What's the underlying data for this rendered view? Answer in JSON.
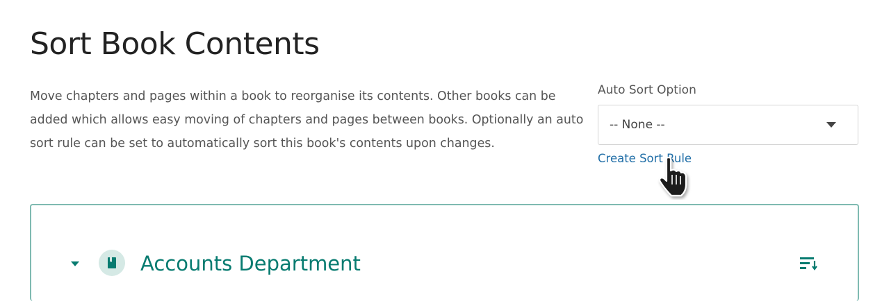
{
  "page": {
    "title": "Sort Book Contents",
    "description": "Move chapters and pages within a book to reorganise its contents. Other books can be added which allows easy moving of chapters and pages between books. Optionally an auto sort rule can be set to automatically sort this book's contents upon changes."
  },
  "auto_sort": {
    "label": "Auto Sort Option",
    "selected": "-- None --",
    "create_link": "Create Sort Rule"
  },
  "book": {
    "name": "Accounts Department"
  },
  "colors": {
    "accent": "#077b70",
    "panel_border": "#7fbab1",
    "icon_bg": "#d5e9e5",
    "link": "#206ea7"
  },
  "icons": [
    "chevron-down-icon",
    "caret-down-icon",
    "book-icon",
    "sort-icon",
    "hand-pointer-icon"
  ]
}
